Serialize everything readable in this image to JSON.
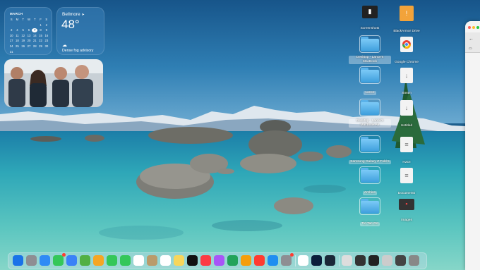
{
  "calendar": {
    "month": "MARCH",
    "weekdays": [
      "S",
      "M",
      "T",
      "W",
      "T",
      "F",
      "S"
    ],
    "days": [
      "",
      "",
      "",
      "",
      "",
      "1",
      "2",
      "3",
      "4",
      "5",
      "6",
      "7",
      "8",
      "9",
      "10",
      "11",
      "12",
      "13",
      "14",
      "15",
      "16",
      "17",
      "18",
      "19",
      "20",
      "21",
      "22",
      "23",
      "24",
      "25",
      "26",
      "27",
      "28",
      "29",
      "30",
      "31"
    ],
    "today": "7"
  },
  "weather": {
    "city": "Bellmore",
    "temperature": "48°",
    "condition": "Dense fog advisory",
    "location_icon": "location-arrow-icon",
    "condition_icon": "cloud-icon"
  },
  "desktop_icons": [
    {
      "label": "Screenshots",
      "icon": "screenshot-folder-icon"
    },
    {
      "label": "BlackArmor Drive",
      "icon": "external-drive-icon"
    },
    {
      "label": "Desktop - Lance's MacBook",
      "icon": "folder-icon"
    },
    {
      "label": "Google Chrome",
      "icon": "chrome-icon"
    },
    {
      "label": "Lance",
      "icon": "folder-icon"
    },
    {
      "label": "Steam",
      "icon": "download-doc-icon"
    },
    {
      "label": "Desktop - Lance's MacBook Air",
      "icon": "folder-icon"
    },
    {
      "label": "Untitled",
      "icon": "download-doc-icon"
    },
    {
      "label": "Samsung Galaxy Z Fold 5",
      "icon": "folder-icon"
    },
    {
      "label": "H2OI",
      "icon": "document-icon"
    },
    {
      "label": "Archive",
      "icon": "folder-icon"
    },
    {
      "label": "Documents",
      "icon": "document-icon"
    },
    {
      "label": "Tic-Tac-Go",
      "icon": "folder-icon"
    },
    {
      "label": "Images",
      "icon": "image-icon"
    }
  ],
  "dock_apps": [
    "finder-icon",
    "launchpad-icon",
    "safari-icon",
    "messages-icon",
    "mail-icon",
    "maps-icon",
    "photos-icon",
    "facetime-icon",
    "phone-icon",
    "calendar-icon",
    "contacts-icon",
    "reminders-icon",
    "notes-icon",
    "apple-tv-icon",
    "music-icon",
    "podcasts-icon",
    "numbers-icon",
    "pages-icon",
    "news-icon",
    "app-store-icon",
    "system-settings-icon",
    "chrome-icon",
    "photoshop-icon",
    "steam-icon",
    "file-icon",
    "screenshot-icon",
    "terminal-icon",
    "preview-icon",
    "window-icon",
    "trash-icon"
  ],
  "colors": {
    "sky": "#1d5f8d",
    "water_light": "#6fd0c8",
    "folder": "#5ab2ea",
    "close": "#ff5f57",
    "minimize": "#febc2e",
    "zoom": "#28c840"
  },
  "finder_window": {
    "back_label": "←"
  }
}
